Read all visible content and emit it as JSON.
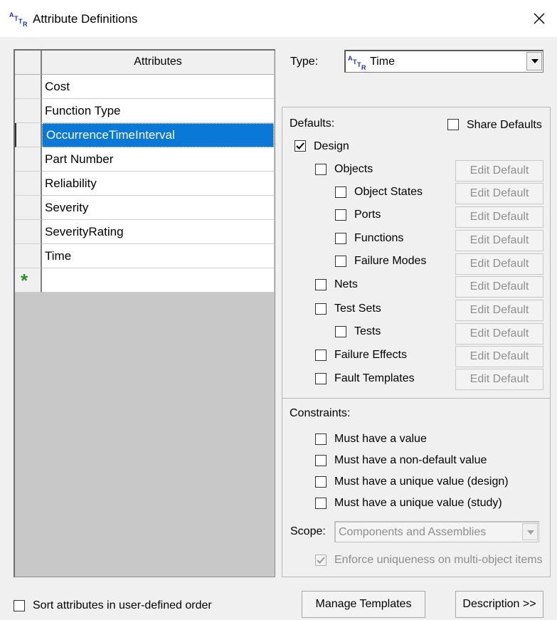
{
  "window": {
    "title": "Attribute Definitions",
    "app_icon": "attr-icon",
    "close_icon": "close-icon"
  },
  "grid": {
    "header": "Attributes",
    "rows": [
      {
        "label": "Cost",
        "selected": false
      },
      {
        "label": "Function Type",
        "selected": false
      },
      {
        "label": "OccurrenceTimeInterval",
        "selected": true
      },
      {
        "label": "Part Number",
        "selected": false
      },
      {
        "label": "Reliability",
        "selected": false
      },
      {
        "label": "Severity",
        "selected": false
      },
      {
        "label": "SeverityRating",
        "selected": false
      },
      {
        "label": "Time",
        "selected": false
      }
    ],
    "new_row_marker": "*"
  },
  "type": {
    "label": "Type:",
    "value": "Time",
    "icon": "attr-icon"
  },
  "defaults": {
    "label": "Defaults:",
    "share_defaults": {
      "label": "Share Defaults",
      "checked": false
    },
    "design": {
      "label": "Design",
      "checked": true
    },
    "edit_default_label": "Edit Default",
    "items": [
      {
        "label": "Objects",
        "checked": false
      },
      {
        "label": "Object States",
        "checked": false
      },
      {
        "label": "Ports",
        "checked": false
      },
      {
        "label": "Functions",
        "checked": false
      },
      {
        "label": "Failure Modes",
        "checked": false
      },
      {
        "label": "Nets",
        "checked": false
      },
      {
        "label": "Test Sets",
        "checked": false
      },
      {
        "label": "Tests",
        "checked": false
      },
      {
        "label": "Failure Effects",
        "checked": false
      },
      {
        "label": "Fault Templates",
        "checked": false
      }
    ]
  },
  "constraints": {
    "label": "Constraints:",
    "items": [
      {
        "label": "Must have a value",
        "checked": false
      },
      {
        "label": "Must have a non-default value",
        "checked": false
      },
      {
        "label": "Must have a unique value (design)",
        "checked": false
      },
      {
        "label": "Must have a unique value (study)",
        "checked": false
      }
    ],
    "scope": {
      "label": "Scope:",
      "value": "Components and Assemblies"
    },
    "enforce": {
      "label": "Enforce uniqueness on multi-object items",
      "checked": true
    }
  },
  "footer": {
    "sort_label": "Sort attributes in user-defined order",
    "sort_checked": false,
    "manage_templates": "Manage Templates",
    "description": "Description >>"
  },
  "colors": {
    "selection": "#0a78d7",
    "new_row_star": "#2a8f2a",
    "attr_icon_blue": "#1e2fd0"
  }
}
